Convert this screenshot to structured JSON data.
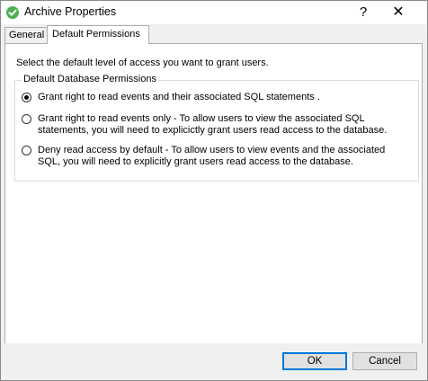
{
  "window": {
    "title": "Archive Properties",
    "help_glyph": "?",
    "close_glyph": "✕",
    "icon": "green-check-circle-icon",
    "accent_color": "#4caf50"
  },
  "tabs": [
    {
      "label": "General",
      "selected": false
    },
    {
      "label": "Default Permissions",
      "selected": true
    }
  ],
  "panel": {
    "intro": "Select the default level of access you want to grant users.",
    "group_title": "Default Database Permissions",
    "options": [
      {
        "label": "Grant right to read events and their associated SQL statements .",
        "checked": true
      },
      {
        "label": "Grant right to read events only - To allow users to view the associated SQL statements, you will need to explicictly grant users read access to the database.",
        "checked": false
      },
      {
        "label": "Deny read access by default - To allow users to view events and the associated SQL, you will need to explicitly grant users read access to the database.",
        "checked": false
      }
    ]
  },
  "buttons": {
    "ok": "OK",
    "cancel": "Cancel"
  }
}
